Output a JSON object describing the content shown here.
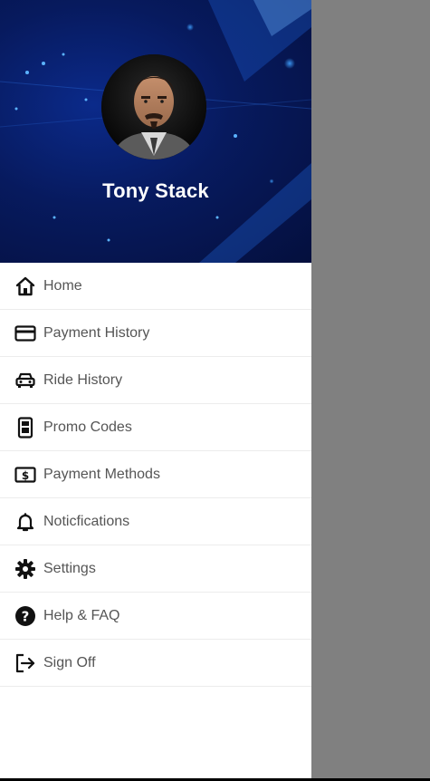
{
  "profile": {
    "name": "Tony Stack"
  },
  "menu": {
    "items": [
      {
        "label": "Home",
        "icon": "home-icon"
      },
      {
        "label": "Payment History",
        "icon": "credit-card-icon"
      },
      {
        "label": "Ride History",
        "icon": "car-icon"
      },
      {
        "label": "Promo Codes",
        "icon": "ticket-icon"
      },
      {
        "label": "Payment Methods",
        "icon": "cash-icon"
      },
      {
        "label": "Noticfications",
        "icon": "bell-icon"
      },
      {
        "label": "Settings",
        "icon": "gear-icon"
      },
      {
        "label": "Help & FAQ",
        "icon": "help-icon"
      },
      {
        "label": "Sign Off",
        "icon": "sign-out-icon"
      }
    ]
  },
  "colors": {
    "header_bg": "#071a5e",
    "scrim": "#808080",
    "label_text": "#555555",
    "icon": "#111111"
  }
}
